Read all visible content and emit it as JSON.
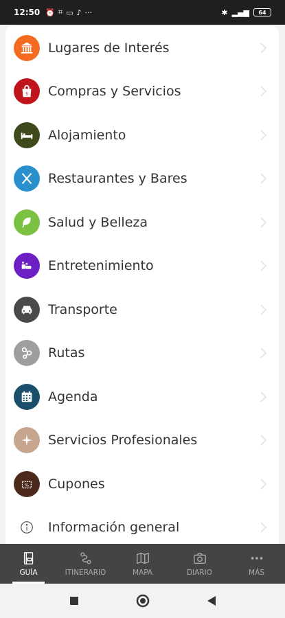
{
  "status_bar": {
    "time": "12:50",
    "left_icons": [
      "alarm-icon",
      "grid-icon",
      "laptop-icon",
      "tiktok-icon",
      "more-icon"
    ],
    "right_icons": [
      "bluetooth-icon",
      "signal-icon",
      "battery-icon"
    ],
    "battery": "64"
  },
  "menu": {
    "items": [
      {
        "label": "Lugares de Interés",
        "icon": "museum-icon",
        "color": "#f26b21"
      },
      {
        "label": "Compras y Servicios",
        "icon": "shopping-bag-icon",
        "color": "#c0141c"
      },
      {
        "label": "Alojamiento",
        "icon": "bed-icon",
        "color": "#3f4a1c"
      },
      {
        "label": "Restaurantes y Bares",
        "icon": "cutlery-icon",
        "color": "#2a8fcd"
      },
      {
        "label": "Salud y Belleza",
        "icon": "leaf-icon",
        "color": "#7bc142"
      },
      {
        "label": "Entretenimiento",
        "icon": "entertainment-icon",
        "color": "#6c1fc2"
      },
      {
        "label": "Transporte",
        "icon": "car-icon",
        "color": "#4a4a4a"
      },
      {
        "label": "Rutas",
        "icon": "route-icon",
        "color": "#9e9e9e"
      },
      {
        "label": "Agenda",
        "icon": "calendar-icon",
        "color": "#1a4e6b"
      },
      {
        "label": "Servicios Profesionales",
        "icon": "compass-icon",
        "color": "#c6a58e"
      },
      {
        "label": "Cupones",
        "icon": "coupon-icon",
        "color": "#4b2a1c"
      },
      {
        "label": "Información general",
        "icon": "info-icon",
        "color": "#ffffff"
      }
    ]
  },
  "bottom_nav": {
    "tabs": [
      {
        "label": "GUÍA",
        "icon": "book-icon",
        "active": true
      },
      {
        "label": "ITINERARIO",
        "icon": "itinerary-icon",
        "active": false
      },
      {
        "label": "MAPA",
        "icon": "map-icon",
        "active": false
      },
      {
        "label": "DIARIO",
        "icon": "camera-icon",
        "active": false
      },
      {
        "label": "MÁS",
        "icon": "more-icon",
        "active": false
      }
    ]
  },
  "system_nav": {
    "buttons": [
      "recents-icon",
      "home-icon",
      "back-icon"
    ]
  }
}
